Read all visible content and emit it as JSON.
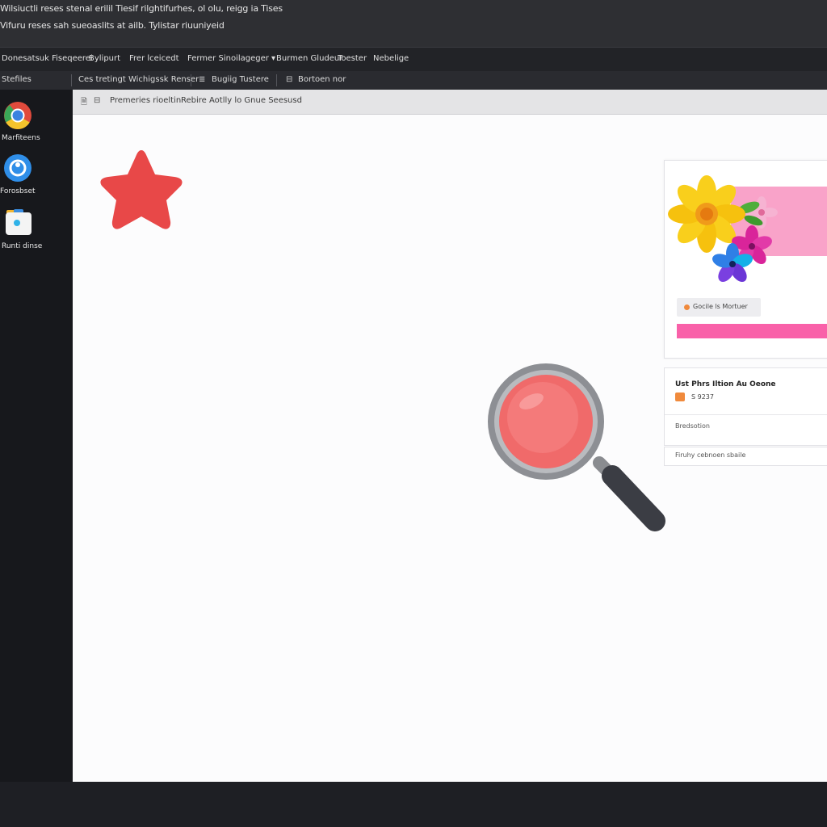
{
  "titlebar": {
    "line1": "Wilsiuctli reses stenal erilil Tiesif rilghtifurhes, ol olu, reigg ia  Tises",
    "line2": "Vifuru reses sah  sueoaslits at ailb.  Tylistar          riuuniyeid"
  },
  "menubar": {
    "items": [
      "Donesatsuk Fiseqeerei",
      "Bylipurt",
      "Frer lceicedt",
      "Fermer Sinoilageger ▾",
      "Burmen Gludeur",
      "Toester",
      "Nebelige"
    ]
  },
  "toolbar": {
    "left_label": "Stefiles",
    "item1": "Ces tretingt Wichigssk Renser",
    "item2": "Bugiig Tustere",
    "item3": "Bortoen nor"
  },
  "desktop_icons": [
    {
      "label": "Marfiteens",
      "icon": "chrome-icon"
    },
    {
      "label": "Forosbset",
      "icon": "app-icon"
    },
    {
      "label": "Runti dinse",
      "icon": "folder-icon"
    }
  ],
  "document": {
    "tab1": "Premeries rioeltin",
    "tab2": "Rebire Aotlly lo Gnue Seesusd"
  },
  "card1": {
    "chip_label": "Gocile ls Mortuer"
  },
  "card2": {
    "heading": "Ust Phrs Iltion Au Oeone",
    "value": "S 9237",
    "subtext": "Bredsotion"
  },
  "card3": {
    "text": "Firuhy cebnoen sbaile"
  },
  "colors": {
    "star": "#e84848",
    "lens": "#f06a6a",
    "pink_banner": "#f9a3c9",
    "pink_bar": "#f961a9",
    "accent_orange": "#f08a3c"
  }
}
